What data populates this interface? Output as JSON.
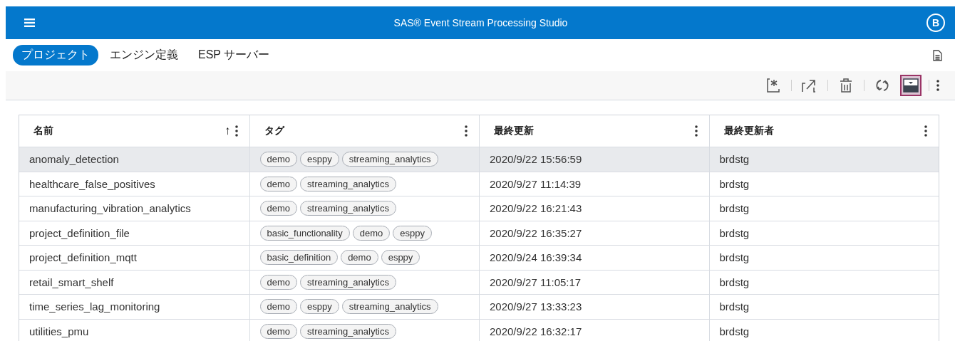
{
  "header": {
    "title": "SAS® Event Stream Processing Studio",
    "user_initial": "B"
  },
  "tabs": [
    {
      "label": "プロジェクト",
      "selected": true
    },
    {
      "label": "エンジン定義",
      "selected": false
    },
    {
      "label": "ESP サーバー",
      "selected": false
    }
  ],
  "toolbar": [
    {
      "kind": "new",
      "on": false
    },
    {
      "kind": "export",
      "on": false
    },
    {
      "kind": "delete",
      "on": false
    },
    {
      "kind": "refresh",
      "on": false
    },
    {
      "kind": "panel",
      "on": true
    }
  ],
  "table": {
    "columns": [
      {
        "label": "名前",
        "sort": "↑"
      },
      {
        "label": "タグ"
      },
      {
        "label": "最終更新"
      },
      {
        "label": "最終更新者"
      }
    ],
    "rows": [
      {
        "name": "anomaly_detection",
        "tags": [
          "demo",
          "esppy",
          "streaming_analytics"
        ],
        "modified": "2020/9/22 15:56:59",
        "by": "brdstg",
        "selected": true
      },
      {
        "name": "healthcare_false_positives",
        "tags": [
          "demo",
          "streaming_analytics"
        ],
        "modified": "2020/9/27 11:14:39",
        "by": "brdstg",
        "selected": false
      },
      {
        "name": "manufacturing_vibration_analytics",
        "tags": [
          "demo",
          "streaming_analytics"
        ],
        "modified": "2020/9/22 16:21:43",
        "by": "brdstg",
        "selected": false
      },
      {
        "name": "project_definition_file",
        "tags": [
          "basic_functionality",
          "demo",
          "esppy"
        ],
        "modified": "2020/9/22 16:35:27",
        "by": "brdstg",
        "selected": false
      },
      {
        "name": "project_definition_mqtt",
        "tags": [
          "basic_definition",
          "demo",
          "esppy"
        ],
        "modified": "2020/9/24 16:39:34",
        "by": "brdstg",
        "selected": false
      },
      {
        "name": "retail_smart_shelf",
        "tags": [
          "demo",
          "streaming_analytics"
        ],
        "modified": "2020/9/27 11:05:17",
        "by": "brdstg",
        "selected": false
      },
      {
        "name": "time_series_lag_monitoring",
        "tags": [
          "demo",
          "esppy",
          "streaming_analytics"
        ],
        "modified": "2020/9/27 13:33:23",
        "by": "brdstg",
        "selected": false
      },
      {
        "name": "utilities_pmu",
        "tags": [
          "demo",
          "streaming_analytics"
        ],
        "modified": "2020/9/22 16:32:17",
        "by": "brdstg",
        "selected": false
      }
    ]
  }
}
